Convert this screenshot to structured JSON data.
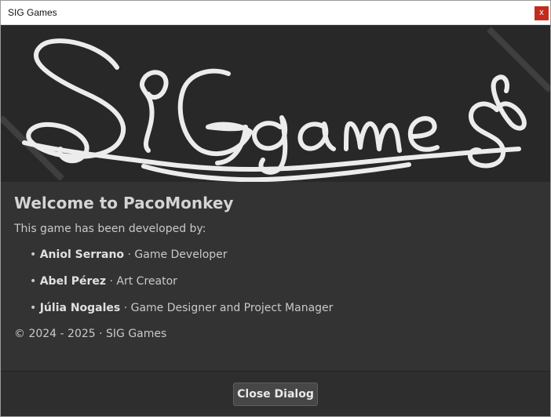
{
  "window": {
    "title": "SIG Games",
    "close_glyph": "x"
  },
  "banner": {
    "logo_text": "SIGgames"
  },
  "content": {
    "welcome": "Welcome to PacoMonkey",
    "developed_by": "This game has been developed by:",
    "credits": [
      {
        "bullet": "•",
        "name": "Aniol Serrano",
        "sep": " · ",
        "role": "Game Developer"
      },
      {
        "bullet": "•",
        "name": "Abel Pérez",
        "sep": " · ",
        "role": "Art Creator"
      },
      {
        "bullet": "•",
        "name": "Júlia Nogales",
        "sep": " · ",
        "role": "Game Designer and Project Manager"
      }
    ],
    "copyright": "© 2024 - 2025 · SIG Games"
  },
  "footer": {
    "close_label": "Close Dialog"
  }
}
